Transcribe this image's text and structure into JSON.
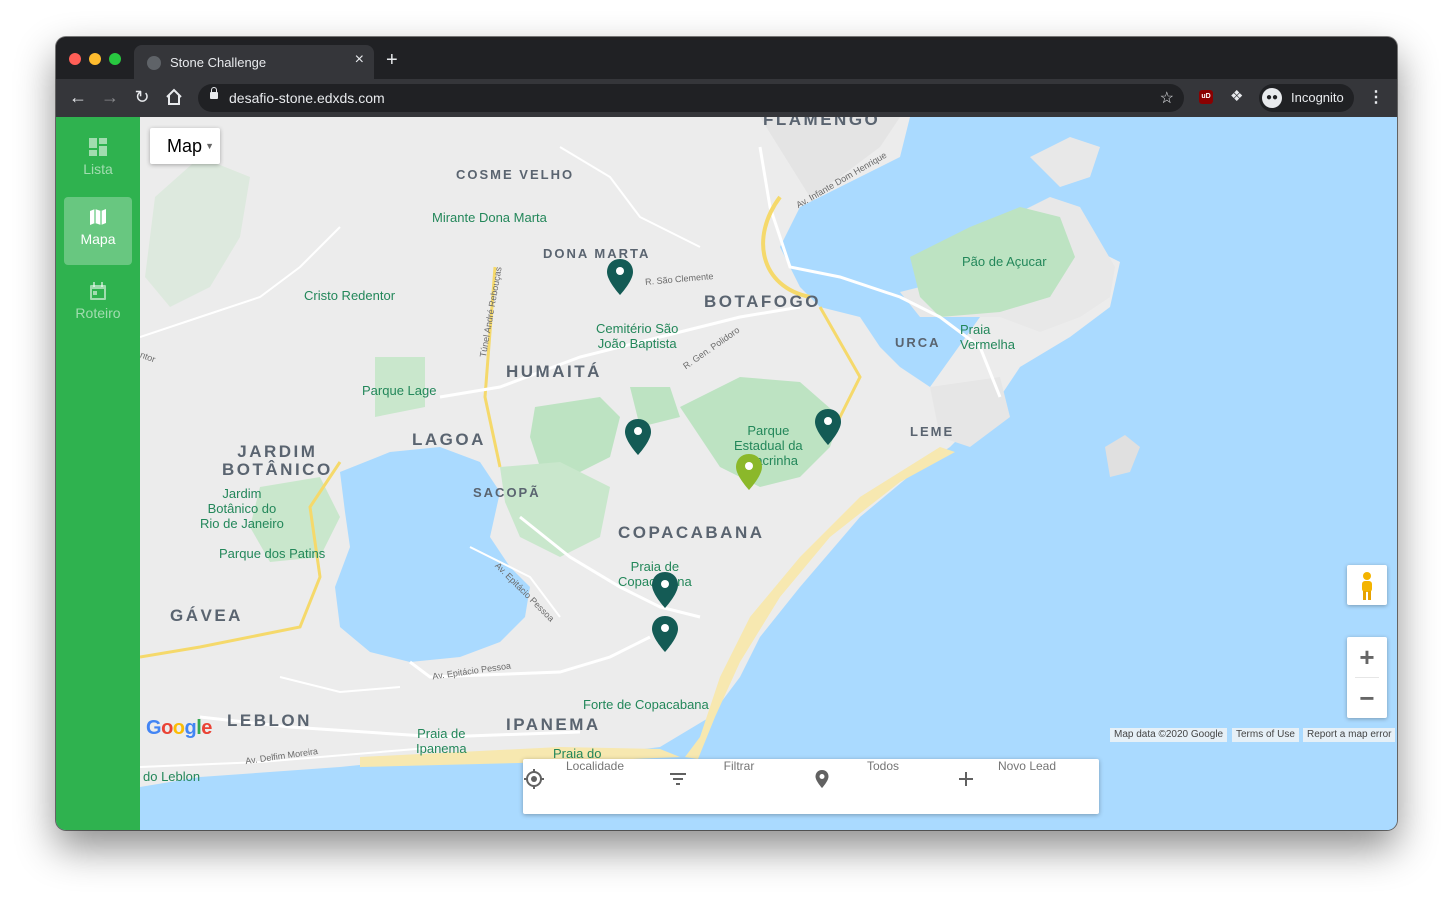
{
  "browser": {
    "tab_title": "Stone Challenge",
    "tab_close": "×",
    "new_tab": "+",
    "url": "desafio-stone.edxds.com",
    "incognito_label": "Incognito",
    "ext_ub": "uD"
  },
  "sidebar": {
    "items": [
      {
        "label": "Lista",
        "icon": "dashboard-icon",
        "active": false
      },
      {
        "label": "Mapa",
        "icon": "map-icon",
        "active": true
      },
      {
        "label": "Roteiro",
        "icon": "calendar-icon",
        "active": false
      }
    ]
  },
  "map": {
    "type_button": "Map",
    "labels": {
      "flamengo": "FLAMENGO",
      "cosme_velho": "COSME VELHO",
      "mirante": "Mirante Dona Marta",
      "dona_marta": "DONA MARTA",
      "cristo": "Cristo Redentor",
      "botafogo": "BOTAFOGO",
      "humaita": "HUMAITÁ",
      "cemiterio": "Cemitério São\nJoão Baptista",
      "parque_lage": "Parque Lage",
      "urca": "URCA",
      "pao_acucar": "Pão de Açucar",
      "praia_vermelha": "Praia\nVermelha",
      "jardim_botanico_district": "JARDIM\nBOTÂNICO",
      "lagoa": "LAGOA",
      "sacopa": "SACOPÃ",
      "parque_chacrinha": "Parque\nEstadual da\nChacrinha",
      "leme": "LEME",
      "jardim_botanico_poi": "Jardim\nBotânico do\nRio de Janeiro",
      "copacabana": "COPACABANA",
      "parque_patins": "Parque dos Patins",
      "praia_copacabana": "Praia de\nCopacabana",
      "gavea": "GÁVEA",
      "leblon": "LEBLON",
      "ipanema": "IPANEMA",
      "praia_ipanema": "Praia de\nIpanema",
      "forte": "Forte de Copacabana",
      "do_leblon": "do Leblon",
      "praia_do": "Praia do",
      "street_sao_clemente": "R. São Clemente",
      "street_polidoro": "R. Gen. Polidoro",
      "street_tunel": "Túnel André Rebouças",
      "street_infante": "Av. Infante Dom Henrique",
      "street_epitacio": "Av. Epitácio Pessoa",
      "street_epitacio2": "Av. Epitácio Pessoa",
      "street_delfim": "Av. Delfim Moreira",
      "street_tor": "ntor"
    },
    "attribution": {
      "data": "Map data ©2020 Google",
      "terms": "Terms of Use",
      "report": "Report a map error"
    },
    "google_logo": "Google",
    "zoom_in": "+",
    "zoom_out": "−",
    "marker_colors": {
      "dark": "#145b55",
      "light": "#8bb82a"
    }
  },
  "bottom_bar": {
    "items": [
      {
        "label": "Localidade",
        "icon": "my-location-icon"
      },
      {
        "label": "Filtrar",
        "icon": "filter-icon"
      },
      {
        "label": "Todos",
        "icon": "place-icon"
      },
      {
        "label": "Novo Lead",
        "icon": "add-icon"
      }
    ]
  }
}
